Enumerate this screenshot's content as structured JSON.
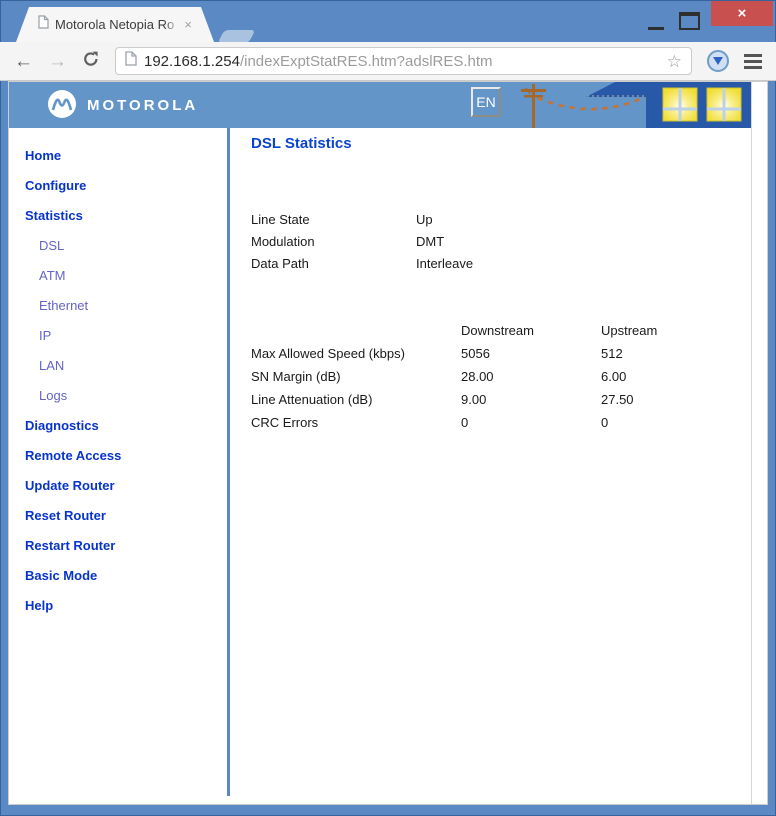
{
  "tab": {
    "title": "Motorola Netopia Ro",
    "close_glyph": "×"
  },
  "window_controls": {
    "close_glyph": "×"
  },
  "toolbar": {
    "back_glyph": "←",
    "forward_glyph": "→",
    "star_glyph": "☆",
    "url_domain": "192.168.1.254",
    "url_path": "/indexExptStatRES.htm?adslRES.htm"
  },
  "site_header": {
    "brand": "MOTOROLA",
    "language": "EN"
  },
  "sidebar": {
    "items": [
      {
        "label": "Home",
        "type": "main"
      },
      {
        "label": "Configure",
        "type": "main"
      },
      {
        "label": "Statistics",
        "type": "main"
      },
      {
        "label": "DSL",
        "type": "sub"
      },
      {
        "label": "ATM",
        "type": "sub"
      },
      {
        "label": "Ethernet",
        "type": "sub"
      },
      {
        "label": "IP",
        "type": "sub"
      },
      {
        "label": "LAN",
        "type": "sub"
      },
      {
        "label": "Logs",
        "type": "sub"
      },
      {
        "label": "Diagnostics",
        "type": "main"
      },
      {
        "label": "Remote Access",
        "type": "main"
      },
      {
        "label": "Update Router",
        "type": "main"
      },
      {
        "label": "Reset Router",
        "type": "main"
      },
      {
        "label": "Restart Router",
        "type": "main"
      },
      {
        "label": "Basic Mode",
        "type": "main"
      },
      {
        "label": "Help",
        "type": "main"
      }
    ]
  },
  "content": {
    "title": "DSL Statistics",
    "status_rows": [
      {
        "label": "Line State",
        "value": "Up"
      },
      {
        "label": "Modulation",
        "value": "DMT"
      },
      {
        "label": "Data Path",
        "value": "Interleave"
      }
    ],
    "stats_table": {
      "columns": {
        "downstream": "Downstream",
        "upstream": "Upstream"
      },
      "rows": [
        {
          "label": "Max Allowed Speed (kbps)",
          "downstream": "5056",
          "upstream": "512"
        },
        {
          "label": "SN Margin (dB)",
          "downstream": "28.00",
          "upstream": "6.00"
        },
        {
          "label": "Line Attenuation (dB)",
          "downstream": "9.00",
          "upstream": "27.50"
        },
        {
          "label": "CRC Errors",
          "downstream": "0",
          "upstream": "0"
        }
      ]
    }
  },
  "colors": {
    "frame_blue": "#5b89c4",
    "header_blue": "#6495c8",
    "house_blue": "#2859a8",
    "close_red": "#c85150",
    "sidebar_main_link": "#0734cd",
    "sidebar_sub_link": "#6464ca",
    "heading_blue": "#0a44d2",
    "window_yellow": "#f0de35",
    "pole_brown": "#a5682a"
  }
}
